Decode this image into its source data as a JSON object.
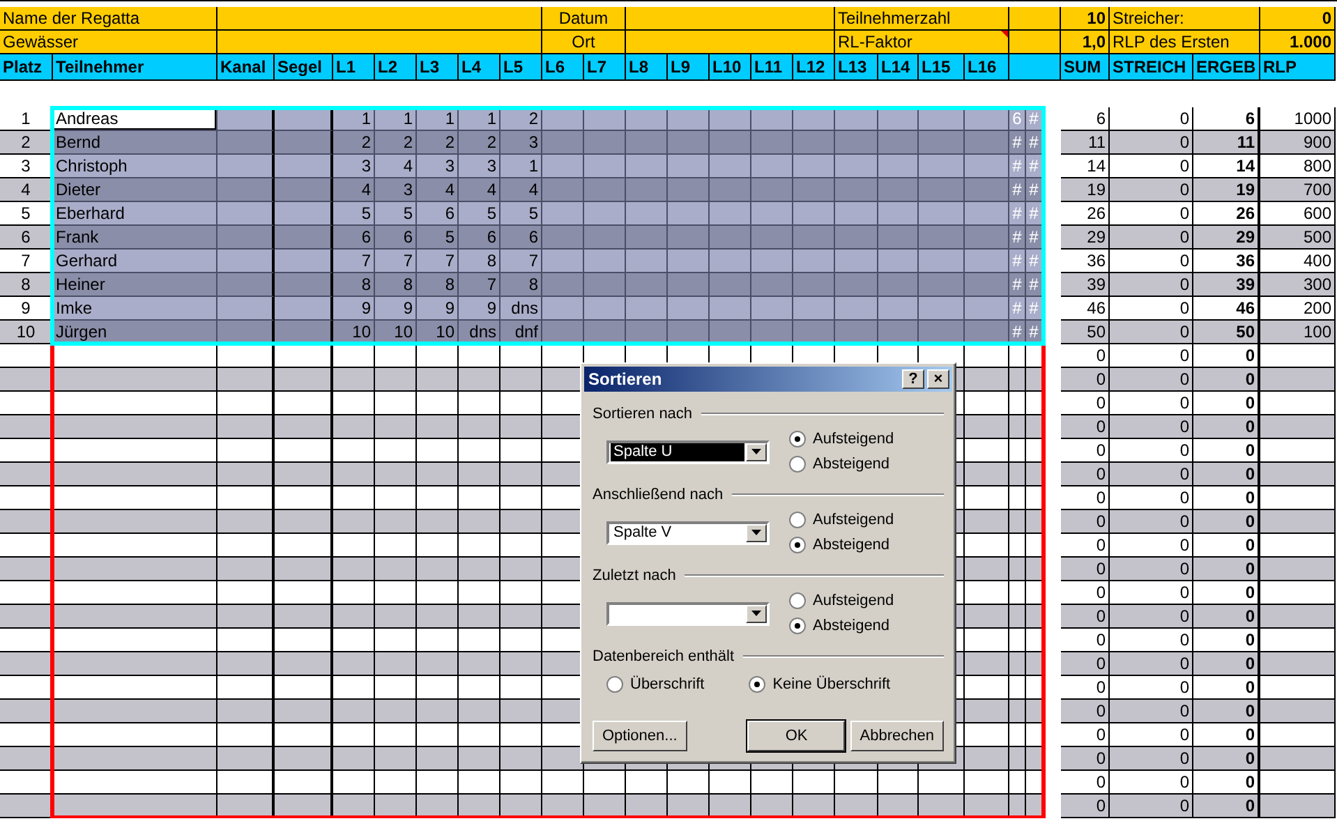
{
  "sheet": {
    "info_rows": [
      {
        "label": "Name der Regatta",
        "mid_label": "Datum",
        "right_label": "Teilnehmerzahl",
        "right_value": "10",
        "extra_label": "Streicher:",
        "extra_value": "0",
        "comment": false
      },
      {
        "label": "Gewässer",
        "mid_label": "Ort",
        "right_label": "RL-Faktor",
        "right_value": "1,0",
        "extra_label": "RLP des Ersten",
        "extra_value": "1.000",
        "comment": true
      }
    ],
    "columns": [
      "Platz",
      "Teilnehmer",
      "Kanal",
      "Segel",
      "L1",
      "L2",
      "L3",
      "L4",
      "L5",
      "L6",
      "L7",
      "L8",
      "L9",
      "L10",
      "L11",
      "L12",
      "L13",
      "L14",
      "L15",
      "L16",
      "SUM",
      "STREICH",
      "ERGEB",
      "RLP"
    ],
    "rows": [
      {
        "platz": "1",
        "name": "Andreas",
        "results": [
          "1",
          "1",
          "1",
          "1",
          "2"
        ],
        "col_21": "6",
        "col_22": "#",
        "sum": "6",
        "streich": "0",
        "ergeb": "6",
        "rlp": "1000",
        "selected": true,
        "active": true
      },
      {
        "platz": "2",
        "name": "Bernd",
        "results": [
          "2",
          "2",
          "2",
          "2",
          "3"
        ],
        "col_21": "#",
        "col_22": "#",
        "sum": "11",
        "streich": "0",
        "ergeb": "11",
        "rlp": "900",
        "selected": true,
        "active": false
      },
      {
        "platz": "3",
        "name": "Christoph",
        "results": [
          "3",
          "4",
          "3",
          "3",
          "1"
        ],
        "col_21": "#",
        "col_22": "#",
        "sum": "14",
        "streich": "0",
        "ergeb": "14",
        "rlp": "800",
        "selected": true,
        "active": false
      },
      {
        "platz": "4",
        "name": "Dieter",
        "results": [
          "4",
          "3",
          "4",
          "4",
          "4"
        ],
        "col_21": "#",
        "col_22": "#",
        "sum": "19",
        "streich": "0",
        "ergeb": "19",
        "rlp": "700",
        "selected": true,
        "active": false
      },
      {
        "platz": "5",
        "name": "Eberhard",
        "results": [
          "5",
          "5",
          "6",
          "5",
          "5"
        ],
        "col_21": "#",
        "col_22": "#",
        "sum": "26",
        "streich": "0",
        "ergeb": "26",
        "rlp": "600",
        "selected": true,
        "active": false
      },
      {
        "platz": "6",
        "name": "Frank",
        "results": [
          "6",
          "6",
          "5",
          "6",
          "6"
        ],
        "col_21": "#",
        "col_22": "#",
        "sum": "29",
        "streich": "0",
        "ergeb": "29",
        "rlp": "500",
        "selected": true,
        "active": false
      },
      {
        "platz": "7",
        "name": "Gerhard",
        "results": [
          "7",
          "7",
          "7",
          "8",
          "7"
        ],
        "col_21": "#",
        "col_22": "#",
        "sum": "36",
        "streich": "0",
        "ergeb": "36",
        "rlp": "400",
        "selected": true,
        "active": false
      },
      {
        "platz": "8",
        "name": "Heiner",
        "results": [
          "8",
          "8",
          "8",
          "7",
          "8"
        ],
        "col_21": "#",
        "col_22": "#",
        "sum": "39",
        "streich": "0",
        "ergeb": "39",
        "rlp": "300",
        "selected": true,
        "active": false
      },
      {
        "platz": "9",
        "name": "Imke",
        "results": [
          "9",
          "9",
          "9",
          "9",
          "dns"
        ],
        "col_21": "#",
        "col_22": "#",
        "sum": "46",
        "streich": "0",
        "ergeb": "46",
        "rlp": "200",
        "selected": true,
        "active": false
      },
      {
        "platz": "10",
        "name": "Jürgen",
        "results": [
          "10",
          "10",
          "10",
          "dns",
          "dnf"
        ],
        "col_21": "#",
        "col_22": "#",
        "sum": "50",
        "streich": "0",
        "ergeb": "50",
        "rlp": "100",
        "selected": true,
        "active": false
      },
      {
        "sum": "0",
        "streich": "0",
        "ergeb": "0",
        "selected": false,
        "active": false
      },
      {
        "sum": "0",
        "streich": "0",
        "ergeb": "0",
        "selected": false,
        "active": false
      },
      {
        "sum": "0",
        "streich": "0",
        "ergeb": "0",
        "selected": false,
        "active": false
      },
      {
        "sum": "0",
        "streich": "0",
        "ergeb": "0",
        "selected": false,
        "active": false
      },
      {
        "sum": "0",
        "streich": "0",
        "ergeb": "0",
        "selected": false,
        "active": false
      },
      {
        "sum": "0",
        "streich": "0",
        "ergeb": "0",
        "selected": false,
        "active": false
      },
      {
        "sum": "0",
        "streich": "0",
        "ergeb": "0",
        "selected": false,
        "active": false
      },
      {
        "sum": "0",
        "streich": "0",
        "ergeb": "0",
        "selected": false,
        "active": false
      },
      {
        "sum": "0",
        "streich": "0",
        "ergeb": "0",
        "selected": false,
        "active": false
      },
      {
        "sum": "0",
        "streich": "0",
        "ergeb": "0",
        "selected": false,
        "active": false
      },
      {
        "sum": "0",
        "streich": "0",
        "ergeb": "0",
        "selected": false,
        "active": false
      },
      {
        "sum": "0",
        "streich": "0",
        "ergeb": "0",
        "selected": false,
        "active": false
      },
      {
        "sum": "0",
        "streich": "0",
        "ergeb": "0",
        "selected": false,
        "active": false
      },
      {
        "sum": "0",
        "streich": "0",
        "ergeb": "0",
        "selected": false,
        "active": false
      },
      {
        "sum": "0",
        "streich": "0",
        "ergeb": "0",
        "selected": false,
        "active": false
      },
      {
        "sum": "0",
        "streich": "0",
        "ergeb": "0",
        "selected": false,
        "active": false
      },
      {
        "sum": "0",
        "streich": "0",
        "ergeb": "0",
        "selected": false,
        "active": false
      },
      {
        "sum": "0",
        "streich": "0",
        "ergeb": "0",
        "selected": false,
        "active": false
      },
      {
        "sum": "0",
        "streich": "0",
        "ergeb": "0",
        "selected": false,
        "active": false
      },
      {
        "sum": "0",
        "streich": "0",
        "ergeb": "0",
        "selected": false,
        "active": false
      }
    ]
  },
  "dialog": {
    "title": "Sortieren",
    "help": "?",
    "close": "×",
    "sort_groups": [
      {
        "label": "Sortieren nach",
        "value": "Spalte U",
        "focused": true,
        "options": [
          {
            "label": "Aufsteigend",
            "selected": true
          },
          {
            "label": "Absteigend",
            "selected": false
          }
        ]
      },
      {
        "label": "Anschließend nach",
        "value": "Spalte V",
        "focused": false,
        "options": [
          {
            "label": "Aufsteigend",
            "selected": false
          },
          {
            "label": "Absteigend",
            "selected": true
          }
        ]
      },
      {
        "label": "Zuletzt nach",
        "focused": false,
        "options": [
          {
            "label": "Aufsteigend",
            "selected": false
          },
          {
            "label": "Absteigend",
            "selected": true
          }
        ]
      }
    ],
    "range_label": "Datenbereich enthält",
    "header_options": [
      {
        "label": "Überschrift",
        "selected": false
      },
      {
        "label": "Keine Überschrift",
        "selected": true
      }
    ],
    "buttons": [
      {
        "label": "Optionen...",
        "default": false
      },
      {
        "label": "OK",
        "default": true
      },
      {
        "label": "Abbrechen",
        "default": false
      }
    ]
  }
}
